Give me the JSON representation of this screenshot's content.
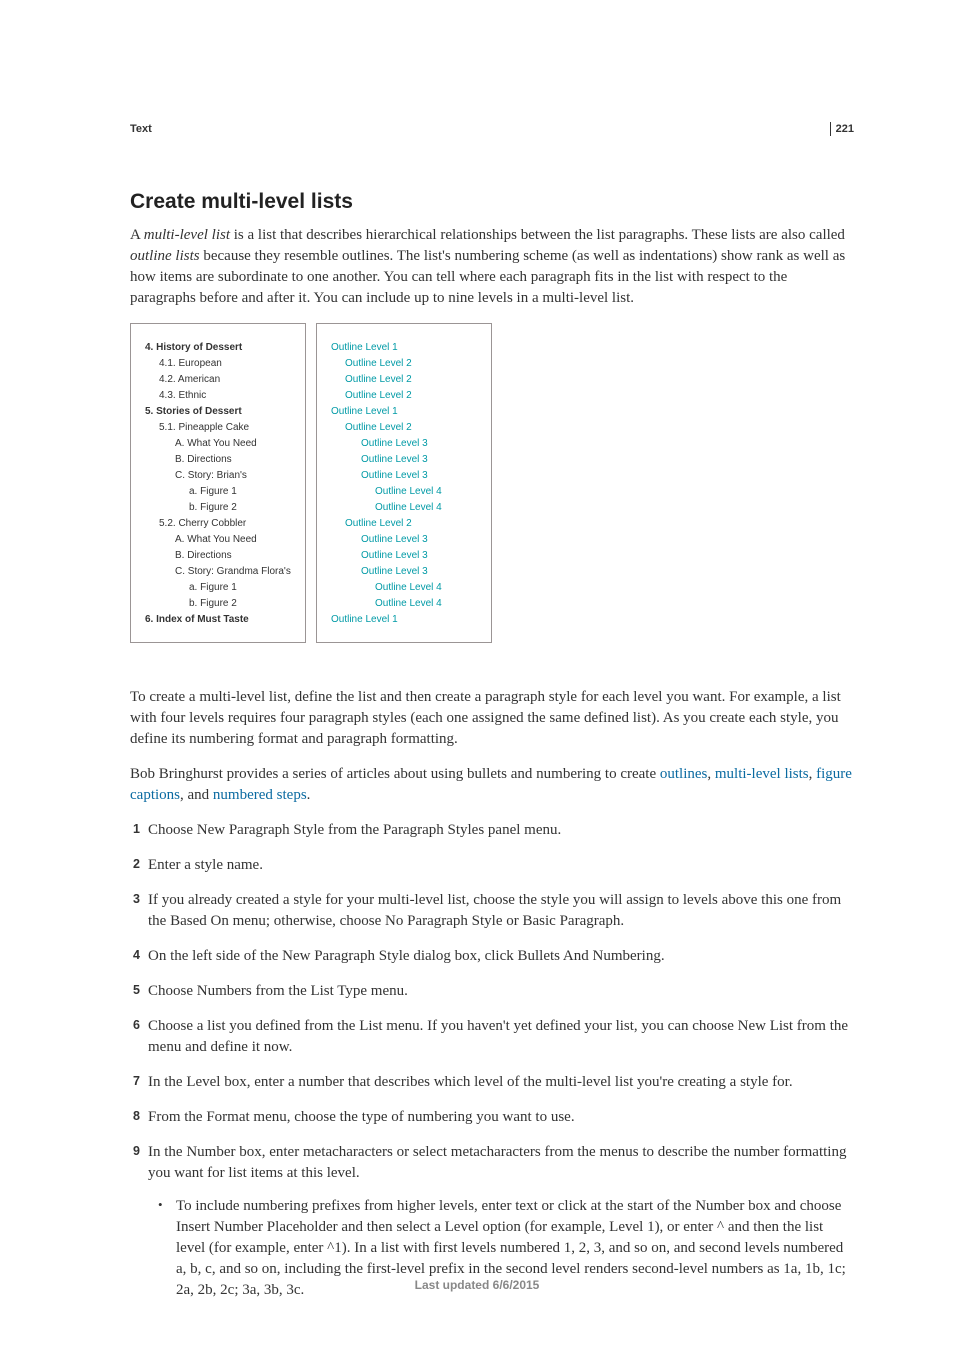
{
  "page_number": "221",
  "header_label": "Text",
  "heading": "Create multi-level lists",
  "intro_prefix": "A ",
  "intro_term": "multi-level list",
  "intro_rest": " is a list that describes hierarchical relationships between the list paragraphs. These lists are also called ",
  "intro_term2": "outline lists",
  "intro_rest2": " because they resemble outlines. The list's numbering scheme (as well as indentations) show rank as well as how items are subordinate to one another. You can tell where each paragraph fits in the list with respect to the paragraphs before and after it. You can include up to nine levels in a multi-level list.",
  "figure_left": [
    {
      "indent": 0,
      "bold": true,
      "text": "4.  History of Dessert"
    },
    {
      "indent": 1,
      "text": "4.1.  European"
    },
    {
      "indent": 1,
      "text": "4.2.  American"
    },
    {
      "indent": 1,
      "text": "4.3.  Ethnic"
    },
    {
      "indent": 0,
      "bold": true,
      "text": "5.  Stories of Dessert"
    },
    {
      "indent": 1,
      "text": "5.1.  Pineapple Cake"
    },
    {
      "indent": 2,
      "text": "A.  What You Need"
    },
    {
      "indent": 2,
      "text": "B.  Directions"
    },
    {
      "indent": 2,
      "text": "C.  Story: Brian's"
    },
    {
      "indent": 3,
      "text": "a.  Figure 1"
    },
    {
      "indent": 3,
      "text": "b.  Figure 2"
    },
    {
      "indent": 1,
      "text": "5.2.  Cherry Cobbler"
    },
    {
      "indent": 2,
      "text": "A.  What You Need"
    },
    {
      "indent": 2,
      "text": "B.  Directions"
    },
    {
      "indent": 2,
      "text": "C.  Story: Grandma Flora's"
    },
    {
      "indent": 3,
      "text": "a.  Figure 1"
    },
    {
      "indent": 3,
      "text": "b.  Figure 2"
    },
    {
      "indent": 0,
      "bold": true,
      "text": "6.  Index of Must Taste"
    }
  ],
  "figure_right": [
    {
      "indent": 0,
      "text": "Outline Level 1"
    },
    {
      "indent": 1,
      "text": "Outline Level 2"
    },
    {
      "indent": 1,
      "text": "Outline Level 2"
    },
    {
      "indent": 1,
      "text": "Outline Level 2"
    },
    {
      "indent": 0,
      "text": "Outline Level 1"
    },
    {
      "indent": 1,
      "text": "Outline Level 2"
    },
    {
      "indent": 2,
      "text": "Outline Level 3"
    },
    {
      "indent": 2,
      "text": "Outline Level 3"
    },
    {
      "indent": 2,
      "text": "Outline Level 3"
    },
    {
      "indent": 3,
      "text": "Outline Level 4"
    },
    {
      "indent": 3,
      "text": "Outline Level 4"
    },
    {
      "indent": 1,
      "text": "Outline Level 2"
    },
    {
      "indent": 2,
      "text": "Outline Level 3"
    },
    {
      "indent": 2,
      "text": "Outline Level 3"
    },
    {
      "indent": 2,
      "text": "Outline Level 3"
    },
    {
      "indent": 3,
      "text": "Outline Level 4"
    },
    {
      "indent": 3,
      "text": "Outline Level 4"
    },
    {
      "indent": 0,
      "text": "Outline Level 1"
    }
  ],
  "para_after_figure": "To create a multi-level list, define the list and then create a paragraph style for each level you want. For example, a list with four levels requires four paragraph styles (each one assigned the same defined list). As you create each style, you define its numbering format and paragraph formatting.",
  "para_bb_prefix": "Bob Bringhurst provides a series of articles about using bullets and numbering to create ",
  "link1": "outlines",
  "sep1": ", ",
  "link2": "multi-level lists",
  "sep2": ", ",
  "link3": "figure captions",
  "sep3": ", and ",
  "link4": "numbered steps",
  "bb_suffix": ".",
  "steps": [
    "Choose New Paragraph Style from the Paragraph Styles panel menu.",
    "Enter a style name.",
    "If you already created a style for your multi-level list, choose the style you will assign to levels above this one from the Based On menu; otherwise, choose No Paragraph Style or Basic Paragraph.",
    "On the left side of the New Paragraph Style dialog box, click Bullets And Numbering.",
    "Choose Numbers from the List Type menu.",
    "Choose a list you defined from the List menu. If you haven't yet defined your list, you can choose New List from the menu and define it now.",
    "In the Level box, enter a number that describes which level of the multi-level list you're creating a style for.",
    "From the Format menu, choose the type of numbering you want to use.",
    "In the Number box, enter metacharacters or select metacharacters from the menus to describe the number formatting you want for list items at this level."
  ],
  "substep": "To include numbering prefixes from higher levels, enter text or click at the start of the Number box and choose Insert Number Placeholder and then select a Level option (for example, Level 1), or enter ^ and then the list level (for example, enter ^1). In a list with first levels numbered 1, 2, 3, and so on, and second levels numbered a, b, c, and so on, including the first-level prefix in the second level renders second-level numbers as 1a, 1b, 1c; 2a, 2b, 2c; 3a, 3b, 3c.",
  "footer": "Last updated 6/6/2015"
}
